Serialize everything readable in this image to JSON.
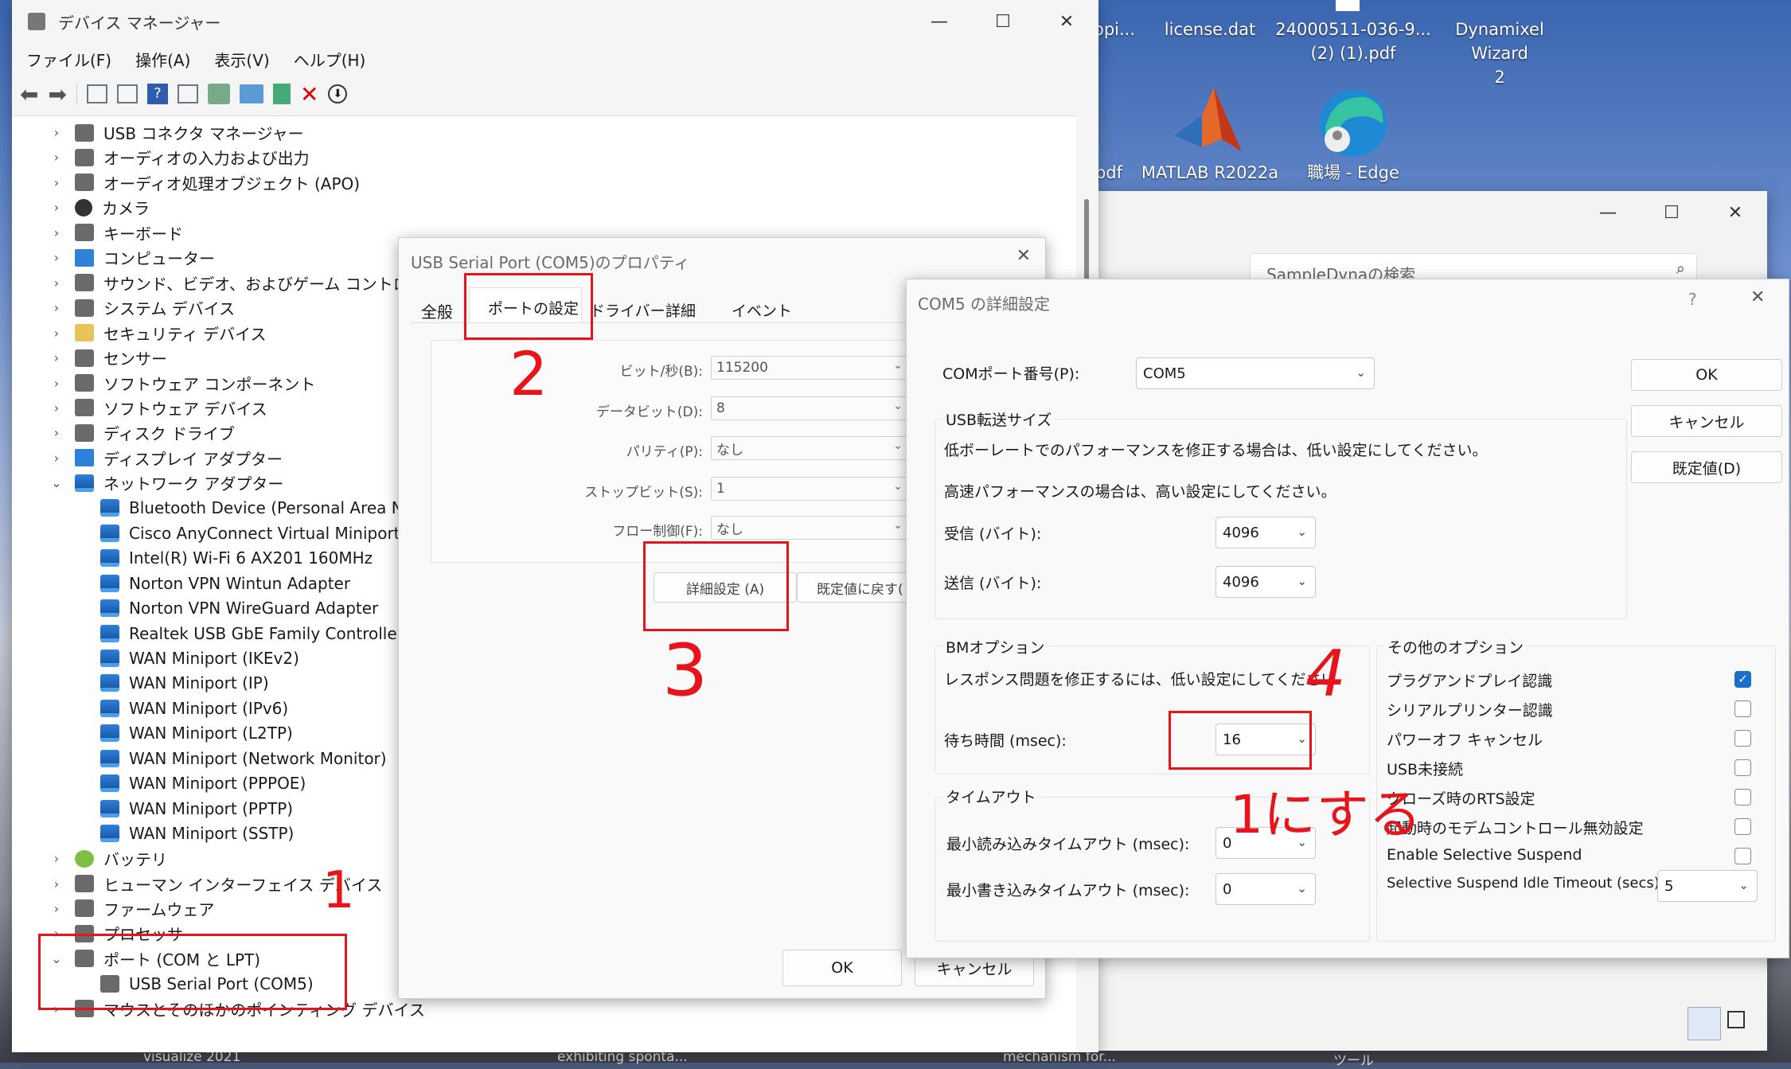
{
  "desktop": {
    "icons": [
      {
        "label": "opi..."
      },
      {
        "label": "license.dat"
      },
      {
        "label": "24000511-036-9...\n(2) (1).pdf"
      },
      {
        "label": "Dynamixel Wizard\n2"
      },
      {
        "label": "pdf"
      },
      {
        "label": "MATLAB R2022a"
      },
      {
        "label": "職場 - Edge"
      }
    ],
    "taskbar_fragments": [
      "visualize 2021",
      "exhibiting sponta...",
      "mechanism for...",
      "ツール"
    ]
  },
  "explorer_window": {
    "search_placeholder": "SampleDynaの検索"
  },
  "device_manager": {
    "title": "デバイス マネージャー",
    "menu": [
      "ファイル(F)",
      "操作(A)",
      "表示(V)",
      "ヘルプ(H)"
    ],
    "tree": [
      {
        "label": "USB コネクタ マネージャー",
        "icon": "usb-connector-icon",
        "expanded": false
      },
      {
        "label": "オーディオの入力および出力",
        "icon": "audio-icon",
        "expanded": false
      },
      {
        "label": "オーディオ処理オブジェクト (APO)",
        "icon": "audio-icon",
        "expanded": false
      },
      {
        "label": "カメラ",
        "icon": "camera-icon",
        "expanded": false
      },
      {
        "label": "キーボード",
        "icon": "keyboard-icon",
        "expanded": false
      },
      {
        "label": "コンピューター",
        "icon": "computer-icon",
        "expanded": false
      },
      {
        "label": "サウンド、ビデオ、およびゲーム コントローラー",
        "icon": "speaker-icon",
        "expanded": false
      },
      {
        "label": "システム デバイス",
        "icon": "system-icon",
        "expanded": false
      },
      {
        "label": "セキュリティ デバイス",
        "icon": "security-icon",
        "expanded": false
      },
      {
        "label": "センサー",
        "icon": "sensor-icon",
        "expanded": false
      },
      {
        "label": "ソフトウェア コンポーネント",
        "icon": "software-icon",
        "expanded": false
      },
      {
        "label": "ソフトウェア デバイス",
        "icon": "software-device-icon",
        "expanded": false
      },
      {
        "label": "ディスク ドライブ",
        "icon": "disk-icon",
        "expanded": false
      },
      {
        "label": "ディスプレイ アダプター",
        "icon": "display-icon",
        "expanded": false
      },
      {
        "label": "ネットワーク アダプター",
        "icon": "network-icon",
        "expanded": true
      },
      {
        "label": "Bluetooth Device (Personal Area Netw",
        "icon": "network-icon",
        "child": true
      },
      {
        "label": "Cisco AnyConnect Virtual Miniport Ac",
        "icon": "network-icon",
        "child": true
      },
      {
        "label": "Intel(R) Wi-Fi 6 AX201 160MHz",
        "icon": "network-icon",
        "child": true
      },
      {
        "label": "Norton VPN Wintun Adapter",
        "icon": "network-icon",
        "child": true
      },
      {
        "label": "Norton VPN WireGuard Adapter",
        "icon": "network-icon",
        "child": true
      },
      {
        "label": "Realtek USB GbE Family Controller",
        "icon": "network-icon",
        "child": true
      },
      {
        "label": "WAN Miniport (IKEv2)",
        "icon": "network-icon",
        "child": true
      },
      {
        "label": "WAN Miniport (IP)",
        "icon": "network-icon",
        "child": true
      },
      {
        "label": "WAN Miniport (IPv6)",
        "icon": "network-icon",
        "child": true
      },
      {
        "label": "WAN Miniport (L2TP)",
        "icon": "network-icon",
        "child": true
      },
      {
        "label": "WAN Miniport (Network Monitor)",
        "icon": "network-icon",
        "child": true
      },
      {
        "label": "WAN Miniport (PPPOE)",
        "icon": "network-icon",
        "child": true
      },
      {
        "label": "WAN Miniport (PPTP)",
        "icon": "network-icon",
        "child": true
      },
      {
        "label": "WAN Miniport (SSTP)",
        "icon": "network-icon",
        "child": true
      },
      {
        "label": "バッテリ",
        "icon": "battery-icon",
        "expanded": false
      },
      {
        "label": "ヒューマン インターフェイス デバイス",
        "icon": "hid-icon",
        "expanded": false
      },
      {
        "label": "ファームウェア",
        "icon": "firmware-icon",
        "expanded": false
      },
      {
        "label": "プロセッサ",
        "icon": "processor-icon",
        "expanded": false
      },
      {
        "label": "ポート (COM と LPT)",
        "icon": "port-icon",
        "expanded": true
      },
      {
        "label": "USB Serial Port (COM5)",
        "icon": "port-icon",
        "child": true
      },
      {
        "label": "マウスとそのほかのポインティング デバイス",
        "icon": "mouse-icon",
        "expanded": false
      }
    ]
  },
  "properties_dialog": {
    "title": "USB Serial Port (COM5)のプロパティ",
    "tabs": [
      "全般",
      "ポートの設定",
      "ドライバー",
      "詳細",
      "イベント"
    ],
    "active_tab": "ポートの設定",
    "fields": [
      {
        "label": "ビット/秒(B):",
        "value": "115200"
      },
      {
        "label": "データビット(D):",
        "value": "8"
      },
      {
        "label": "パリティ(P):",
        "value": "なし"
      },
      {
        "label": "ストップビット(S):",
        "value": "1"
      },
      {
        "label": "フロー制御(F):",
        "value": "なし"
      }
    ],
    "advanced_button": "詳細設定 (A)",
    "restore_button": "既定値に戻す(",
    "ok": "OK",
    "cancel": "キャンセル"
  },
  "advanced_dialog": {
    "title": "COM5 の詳細設定",
    "help": "?",
    "com_port_label": "COMポート番号(P):",
    "com_port_value": "COM5",
    "usb_group": "USB転送サイズ",
    "usb_hint_low": "低ボーレートでのパフォーマンスを修正する場合は、低い設定にしてください。",
    "usb_hint_high": "高速パフォーマンスの場合は、高い設定にしてください。",
    "receive_label": "受信 (バイト):",
    "receive_value": "4096",
    "send_label": "送信 (バイト):",
    "send_value": "4096",
    "bm_group": "BMオプション",
    "bm_hint": "レスポンス問題を修正するには、低い設定にしてください",
    "latency_label": "待ち時間 (msec):",
    "latency_value": "16",
    "timeout_group": "タイムアウト",
    "read_timeout_label": "最小読み込みタイムアウト (msec):",
    "read_timeout_value": "0",
    "write_timeout_label": "最小書き込みタイムアウト (msec):",
    "write_timeout_value": "0",
    "other_group": "その他のオプション",
    "options": [
      {
        "label": "プラグアンドプレイ認識",
        "checked": true
      },
      {
        "label": "シリアルプリンター認識",
        "checked": false
      },
      {
        "label": "パワーオフ キャンセル",
        "checked": false
      },
      {
        "label": "USB未接続",
        "checked": false
      },
      {
        "label": "クローズ時のRTS設定",
        "checked": false
      },
      {
        "label": "起動時のモデムコントロール無効設定",
        "checked": false
      },
      {
        "label": "Enable Selective Suspend",
        "checked": false
      }
    ],
    "idle_timeout_label": "Selective Suspend Idle Timeout (secs):",
    "idle_timeout_value": "5",
    "ok": "OK",
    "cancel": "キャンセル",
    "defaults": "既定値(D)"
  },
  "annotations": {
    "step1": "1",
    "step2": "2",
    "step3": "3",
    "step4": "4",
    "note": "1にする"
  },
  "colors": {
    "annotation_red": "#e8141c",
    "checkbox_blue": "#1a6fc9"
  }
}
